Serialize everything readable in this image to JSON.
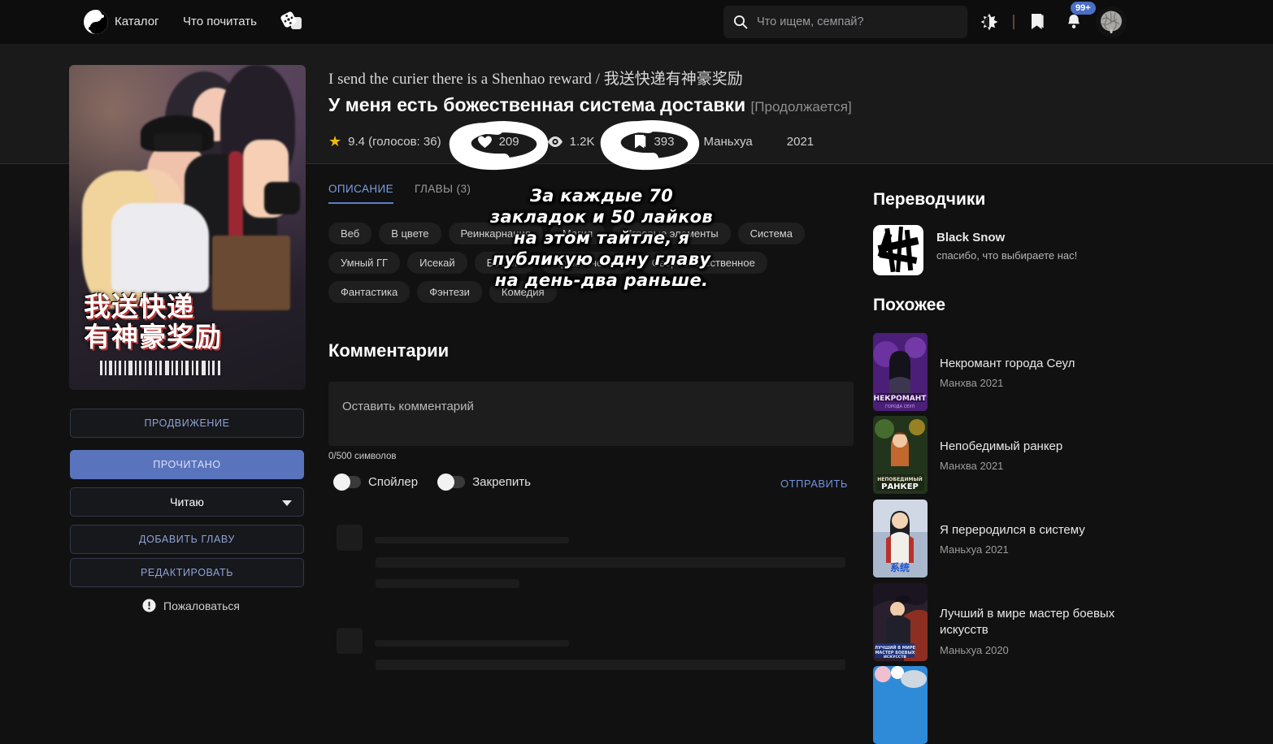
{
  "header": {
    "logo_icon": "yin-yang-logo",
    "nav": [
      {
        "label": "Каталог",
        "name": "nav-catalog"
      },
      {
        "label": "Что почитать",
        "name": "nav-what-to-read"
      }
    ],
    "dice_icon": "dice-icon",
    "search": {
      "placeholder": "Что ищем, семпай?",
      "value": "",
      "icon": "search-icon"
    },
    "theme_icon": "theme-toggle-icon",
    "bookmark_icon": "bookmark-icon",
    "bell_icon": "bell-icon",
    "notification_badge": "99+",
    "avatar_icon": "user-avatar"
  },
  "title": {
    "english": "I send the curier there is a Shenhao reward / 我送快递有神豪奖励",
    "russian": "У меня есть божественная система доставки",
    "status": "[Продолжается]"
  },
  "stats": {
    "rating_icon": "star-icon",
    "rating": "9.4 (голосов: 36)",
    "likes_icon": "heart-icon",
    "likes": "209",
    "views_icon": "eye-icon",
    "views": "1.2K",
    "bookmarks_icon": "bookmark-icon",
    "bookmarks": "393",
    "type": "Маньхуа",
    "year": "2021"
  },
  "tabs": [
    {
      "label": "ОПИСАНИЕ",
      "name": "tab-description",
      "active": true
    },
    {
      "label": "ГЛАВЫ (3)",
      "name": "tab-chapters",
      "active": false
    }
  ],
  "tags": [
    "Веб",
    "В цвете",
    "Реинкарнация",
    "Магия",
    "Игровые элементы",
    "Система",
    "Умный ГГ",
    "Исекай",
    "Боевик",
    "Приключения",
    "Сверхъестественное",
    "Фантастика",
    "Фэнтези",
    "Комедия"
  ],
  "left_actions": {
    "promote": "ПРОДВИЖЕНИЕ",
    "read_state": "ПРОЧИТАНО",
    "status_select": "Читаю",
    "add_chapter": "ДОБАВИТЬ ГЛАВУ",
    "edit": "РЕДАКТИРОВАТЬ",
    "report": "Пожаловаться",
    "report_icon": "warning-icon",
    "caret_icon": "chevron-down-icon"
  },
  "comments": {
    "heading": "Комментарии",
    "placeholder": "Оставить комментарий",
    "value": "",
    "char_count": "0/500 символов",
    "spoiler_label": "Спойлер",
    "pin_label": "Закрепить",
    "send_label": "ОТПРАВИТЬ"
  },
  "sidebar": {
    "translators_heading": "Переводчики",
    "translator": {
      "name": "Black Snow",
      "tagline": "спасибо, что выбираете нас!",
      "logo_icon": "black-snow-logo"
    },
    "similar_heading": "Похожее",
    "similar": [
      {
        "title": "Некромант города Сеул",
        "meta": "Манхва 2021"
      },
      {
        "title": "Непобедимый ранкер",
        "meta": "Манхва 2021"
      },
      {
        "title": "Я переродился в систему",
        "meta": "Маньхуа 2021"
      },
      {
        "title": "Лучший в мире мастер боевых искусств",
        "meta": "Маньхуа 2020"
      },
      {
        "title": "",
        "meta": ""
      }
    ]
  },
  "cover": {
    "chinese_line1": "我送快递",
    "chinese_line2": "有神豪奖励"
  },
  "annotation": {
    "note": "За каждые 70 закладок и 50 лайков на этом тайтле, я публикую одну главу на день-два раньше.",
    "circle_likes": "circle-annotation-likes",
    "circle_bookmarks": "circle-annotation-bookmarks",
    "color": "#ffffff"
  }
}
